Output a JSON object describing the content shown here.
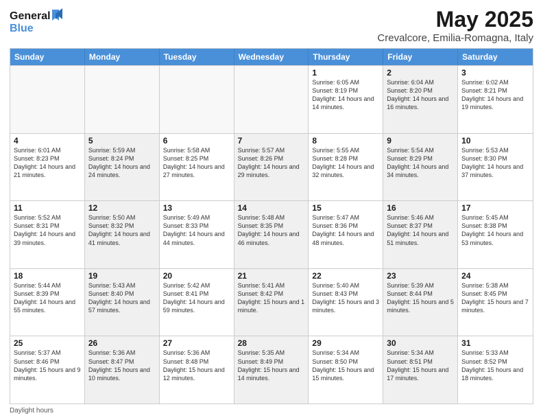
{
  "logo": {
    "line1": "General",
    "line2": "Blue"
  },
  "title": "May 2025",
  "subtitle": "Crevalcore, Emilia-Romagna, Italy",
  "calendar": {
    "headers": [
      "Sunday",
      "Monday",
      "Tuesday",
      "Wednesday",
      "Thursday",
      "Friday",
      "Saturday"
    ],
    "rows": [
      [
        {
          "day": "",
          "text": "",
          "empty": true
        },
        {
          "day": "",
          "text": "",
          "empty": true
        },
        {
          "day": "",
          "text": "",
          "empty": true
        },
        {
          "day": "",
          "text": "",
          "empty": true
        },
        {
          "day": "1",
          "text": "Sunrise: 6:05 AM\nSunset: 8:19 PM\nDaylight: 14 hours and 14 minutes.",
          "empty": false,
          "shaded": false
        },
        {
          "day": "2",
          "text": "Sunrise: 6:04 AM\nSunset: 8:20 PM\nDaylight: 14 hours and 16 minutes.",
          "empty": false,
          "shaded": true
        },
        {
          "day": "3",
          "text": "Sunrise: 6:02 AM\nSunset: 8:21 PM\nDaylight: 14 hours and 19 minutes.",
          "empty": false,
          "shaded": false
        }
      ],
      [
        {
          "day": "4",
          "text": "Sunrise: 6:01 AM\nSunset: 8:23 PM\nDaylight: 14 hours and 21 minutes.",
          "empty": false,
          "shaded": false
        },
        {
          "day": "5",
          "text": "Sunrise: 5:59 AM\nSunset: 8:24 PM\nDaylight: 14 hours and 24 minutes.",
          "empty": false,
          "shaded": true
        },
        {
          "day": "6",
          "text": "Sunrise: 5:58 AM\nSunset: 8:25 PM\nDaylight: 14 hours and 27 minutes.",
          "empty": false,
          "shaded": false
        },
        {
          "day": "7",
          "text": "Sunrise: 5:57 AM\nSunset: 8:26 PM\nDaylight: 14 hours and 29 minutes.",
          "empty": false,
          "shaded": true
        },
        {
          "day": "8",
          "text": "Sunrise: 5:55 AM\nSunset: 8:28 PM\nDaylight: 14 hours and 32 minutes.",
          "empty": false,
          "shaded": false
        },
        {
          "day": "9",
          "text": "Sunrise: 5:54 AM\nSunset: 8:29 PM\nDaylight: 14 hours and 34 minutes.",
          "empty": false,
          "shaded": true
        },
        {
          "day": "10",
          "text": "Sunrise: 5:53 AM\nSunset: 8:30 PM\nDaylight: 14 hours and 37 minutes.",
          "empty": false,
          "shaded": false
        }
      ],
      [
        {
          "day": "11",
          "text": "Sunrise: 5:52 AM\nSunset: 8:31 PM\nDaylight: 14 hours and 39 minutes.",
          "empty": false,
          "shaded": false
        },
        {
          "day": "12",
          "text": "Sunrise: 5:50 AM\nSunset: 8:32 PM\nDaylight: 14 hours and 41 minutes.",
          "empty": false,
          "shaded": true
        },
        {
          "day": "13",
          "text": "Sunrise: 5:49 AM\nSunset: 8:33 PM\nDaylight: 14 hours and 44 minutes.",
          "empty": false,
          "shaded": false
        },
        {
          "day": "14",
          "text": "Sunrise: 5:48 AM\nSunset: 8:35 PM\nDaylight: 14 hours and 46 minutes.",
          "empty": false,
          "shaded": true
        },
        {
          "day": "15",
          "text": "Sunrise: 5:47 AM\nSunset: 8:36 PM\nDaylight: 14 hours and 48 minutes.",
          "empty": false,
          "shaded": false
        },
        {
          "day": "16",
          "text": "Sunrise: 5:46 AM\nSunset: 8:37 PM\nDaylight: 14 hours and 51 minutes.",
          "empty": false,
          "shaded": true
        },
        {
          "day": "17",
          "text": "Sunrise: 5:45 AM\nSunset: 8:38 PM\nDaylight: 14 hours and 53 minutes.",
          "empty": false,
          "shaded": false
        }
      ],
      [
        {
          "day": "18",
          "text": "Sunrise: 5:44 AM\nSunset: 8:39 PM\nDaylight: 14 hours and 55 minutes.",
          "empty": false,
          "shaded": false
        },
        {
          "day": "19",
          "text": "Sunrise: 5:43 AM\nSunset: 8:40 PM\nDaylight: 14 hours and 57 minutes.",
          "empty": false,
          "shaded": true
        },
        {
          "day": "20",
          "text": "Sunrise: 5:42 AM\nSunset: 8:41 PM\nDaylight: 14 hours and 59 minutes.",
          "empty": false,
          "shaded": false
        },
        {
          "day": "21",
          "text": "Sunrise: 5:41 AM\nSunset: 8:42 PM\nDaylight: 15 hours and 1 minute.",
          "empty": false,
          "shaded": true
        },
        {
          "day": "22",
          "text": "Sunrise: 5:40 AM\nSunset: 8:43 PM\nDaylight: 15 hours and 3 minutes.",
          "empty": false,
          "shaded": false
        },
        {
          "day": "23",
          "text": "Sunrise: 5:39 AM\nSunset: 8:44 PM\nDaylight: 15 hours and 5 minutes.",
          "empty": false,
          "shaded": true
        },
        {
          "day": "24",
          "text": "Sunrise: 5:38 AM\nSunset: 8:45 PM\nDaylight: 15 hours and 7 minutes.",
          "empty": false,
          "shaded": false
        }
      ],
      [
        {
          "day": "25",
          "text": "Sunrise: 5:37 AM\nSunset: 8:46 PM\nDaylight: 15 hours and 9 minutes.",
          "empty": false,
          "shaded": false
        },
        {
          "day": "26",
          "text": "Sunrise: 5:36 AM\nSunset: 8:47 PM\nDaylight: 15 hours and 10 minutes.",
          "empty": false,
          "shaded": true
        },
        {
          "day": "27",
          "text": "Sunrise: 5:36 AM\nSunset: 8:48 PM\nDaylight: 15 hours and 12 minutes.",
          "empty": false,
          "shaded": false
        },
        {
          "day": "28",
          "text": "Sunrise: 5:35 AM\nSunset: 8:49 PM\nDaylight: 15 hours and 14 minutes.",
          "empty": false,
          "shaded": true
        },
        {
          "day": "29",
          "text": "Sunrise: 5:34 AM\nSunset: 8:50 PM\nDaylight: 15 hours and 15 minutes.",
          "empty": false,
          "shaded": false
        },
        {
          "day": "30",
          "text": "Sunrise: 5:34 AM\nSunset: 8:51 PM\nDaylight: 15 hours and 17 minutes.",
          "empty": false,
          "shaded": true
        },
        {
          "day": "31",
          "text": "Sunrise: 5:33 AM\nSunset: 8:52 PM\nDaylight: 15 hours and 18 minutes.",
          "empty": false,
          "shaded": false
        }
      ]
    ]
  },
  "footer": "Daylight hours"
}
